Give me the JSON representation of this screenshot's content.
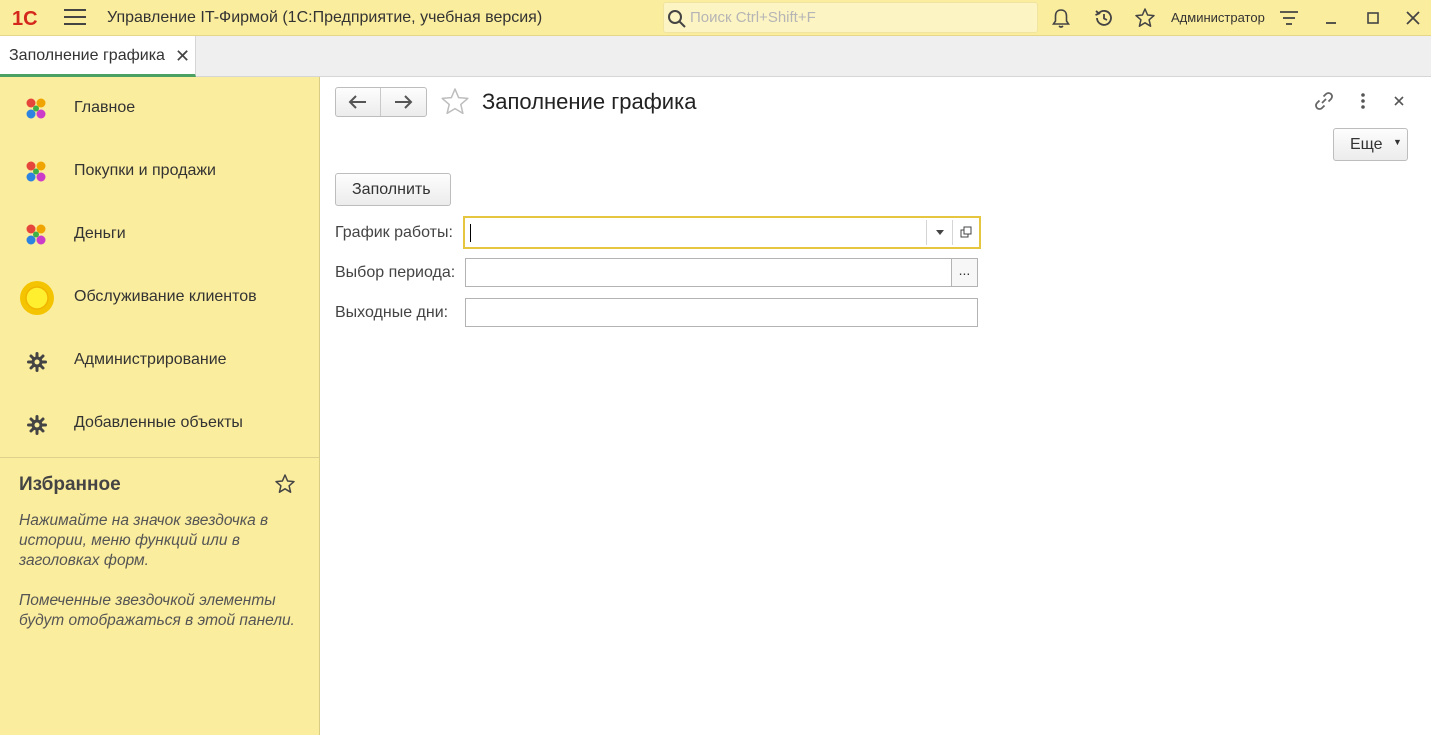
{
  "app": {
    "title": "Управление IT-Фирмой  (1С:Предприятие, учебная версия)",
    "search_placeholder": "Поиск Ctrl+Shift+F",
    "user": "Администратор",
    "accent_color": "#fbed9e",
    "logo_text": "1С"
  },
  "tabs": [
    {
      "label": "Заполнение графика",
      "close": "✕",
      "active": true
    }
  ],
  "sidebar": {
    "items": [
      {
        "label": "Главное",
        "icon": "subsystem-dots-icon"
      },
      {
        "label": "Покупки и продажи",
        "icon": "subsystem-dots-icon"
      },
      {
        "label": "Деньги",
        "icon": "subsystem-dots-icon"
      },
      {
        "label": "Обслуживание клиентов",
        "icon": "yellow-circle-icon"
      },
      {
        "label": "Администрирование",
        "icon": "gear-icon"
      },
      {
        "label": "Добавленные объекты",
        "icon": "gear-icon"
      }
    ],
    "favorites": {
      "title": "Избранное",
      "hint1": "Нажимайте на значок звездочка в истории, меню функций или в заголовках форм.",
      "hint2": "Помеченные звездочкой элементы будут отображаться в этой панели."
    }
  },
  "form": {
    "title": "Заполнение графика",
    "more_label": "Еще",
    "fill_label": "Заполнить",
    "fields": {
      "schedule_label": "График работы:",
      "schedule_value": "",
      "period_label": "Выбор периода:",
      "period_value": "",
      "period_button": "...",
      "weekend_label": "Выходные дни:",
      "weekend_value": ""
    }
  }
}
